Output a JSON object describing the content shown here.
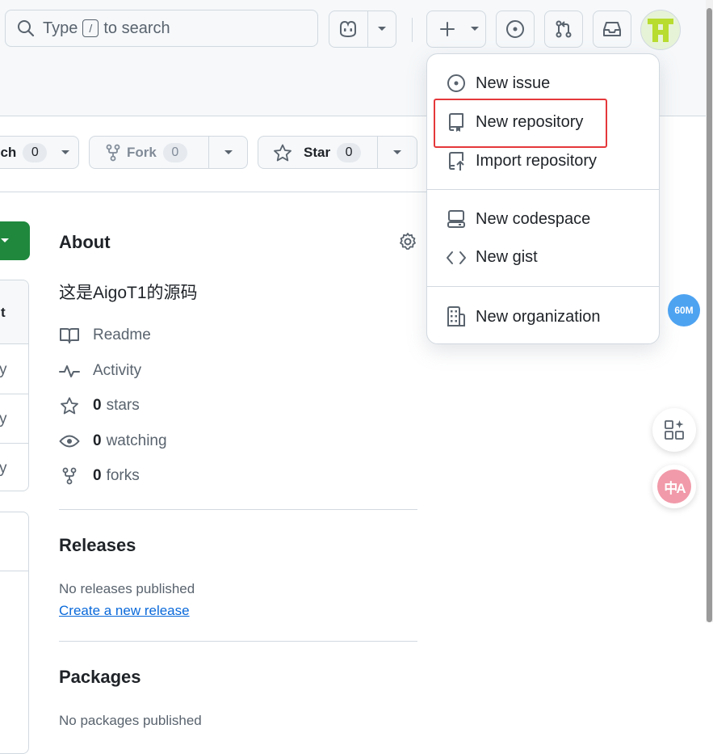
{
  "header": {
    "search": {
      "prefix": "Type",
      "key": "/",
      "suffix": "to search"
    }
  },
  "repo_actions": {
    "watch": {
      "label_visible": "ch",
      "count": "0"
    },
    "fork": {
      "label": "Fork",
      "count": "0"
    },
    "star": {
      "label": "Star",
      "count": "0"
    }
  },
  "left_panel": {
    "items": [
      "t",
      "y",
      "y",
      "y"
    ]
  },
  "about": {
    "title": "About",
    "description": "这是AigoT1的源码",
    "items": [
      {
        "icon": "book-icon",
        "label": "Readme",
        "count": ""
      },
      {
        "icon": "pulse-icon",
        "label": "Activity",
        "count": ""
      },
      {
        "icon": "star-icon",
        "label": "stars",
        "count": "0"
      },
      {
        "icon": "eye-icon",
        "label": "watching",
        "count": "0"
      },
      {
        "icon": "fork-icon",
        "label": "forks",
        "count": "0"
      }
    ]
  },
  "releases": {
    "title": "Releases",
    "empty": "No releases published",
    "create_link": "Create a new release"
  },
  "packages": {
    "title": "Packages",
    "empty": "No packages published"
  },
  "create_menu": {
    "items": [
      {
        "icon": "issue-opened-icon",
        "label": "New issue"
      },
      {
        "icon": "repo-icon",
        "label": "New repository"
      },
      {
        "icon": "repo-push-icon",
        "label": "Import repository"
      },
      {
        "icon": "codespaces-icon",
        "label": "New codespace"
      },
      {
        "icon": "code-icon",
        "label": "New gist"
      },
      {
        "icon": "organization-icon",
        "label": "New organization"
      }
    ]
  },
  "widgets": {
    "memory_badge": "60M",
    "translate_glyph": "中A"
  },
  "colors": {
    "accent_green": "#1f883d",
    "link_blue": "#0969da",
    "highlight_red": "#e5383b",
    "badge_blue": "#4ea3f1",
    "translate_pink": "#f19aa9"
  }
}
